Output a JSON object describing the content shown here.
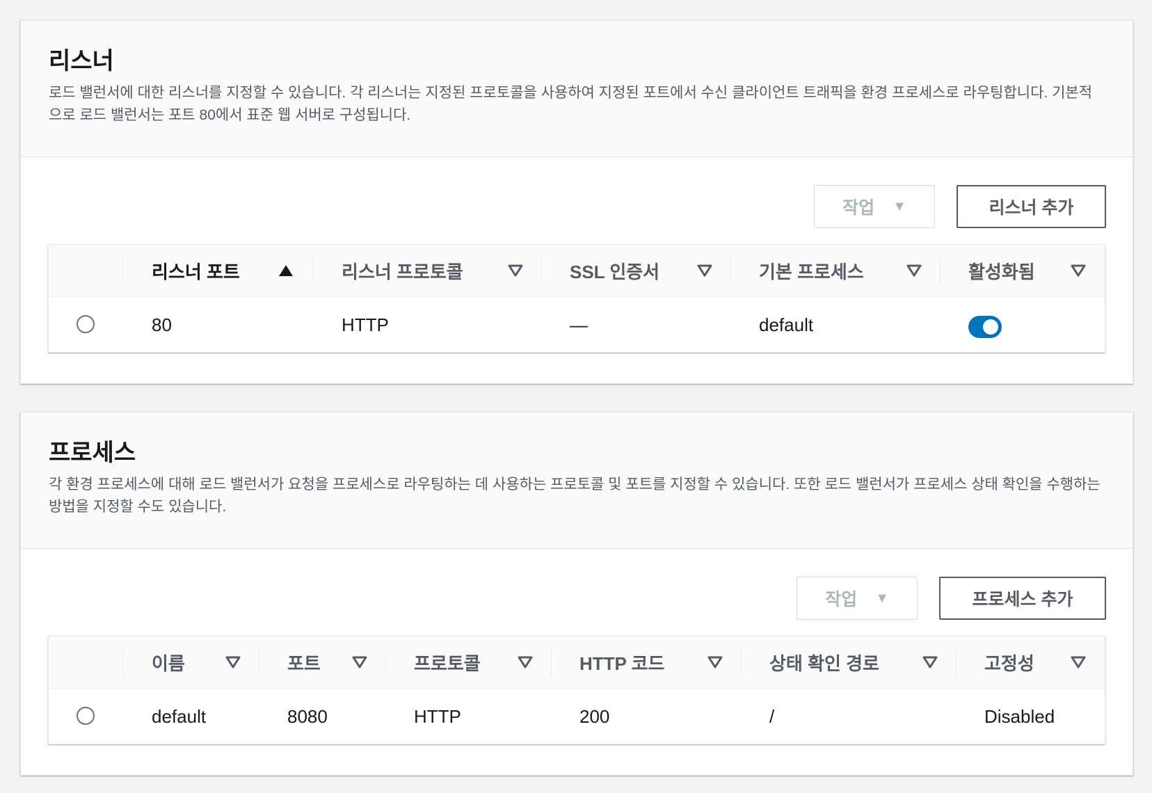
{
  "listeners": {
    "title": "리스너",
    "description": "로드 밸런서에 대한 리스너를 지정할 수 있습니다. 각 리스너는 지정된 프로토콜을 사용하여 지정된 포트에서 수신 클라이언트 트래픽을 환경 프로세스로 라우팅합니다. 기본적으로 로드 밸런서는 포트 80에서 표준 웹 서버로 구성됩니다.",
    "actions_label": "작업",
    "add_label": "리스너 추가",
    "columns": [
      "리스너 포트",
      "리스너 프로토콜",
      "SSL 인증서",
      "기본 프로세스",
      "활성화됨"
    ],
    "sorted_column": "리스너 포트",
    "rows": [
      {
        "port": "80",
        "protocol": "HTTP",
        "ssl": "—",
        "process": "default",
        "enabled": true
      }
    ]
  },
  "processes": {
    "title": "프로세스",
    "description": "각 환경 프로세스에 대해 로드 밸런서가 요청을 프로세스로 라우팅하는 데 사용하는 프로토콜 및 포트를 지정할 수 있습니다. 또한 로드 밸런서가 프로세스 상태 확인을 수행하는 방법을 지정할 수도 있습니다.",
    "actions_label": "작업",
    "add_label": "프로세스 추가",
    "columns": [
      "이름",
      "포트",
      "프로토콜",
      "HTTP 코드",
      "상태 확인 경로",
      "고정성"
    ],
    "rows": [
      {
        "name": "default",
        "port": "8080",
        "protocol": "HTTP",
        "http_code": "200",
        "path": "/",
        "stickiness": "Disabled"
      }
    ]
  },
  "colors": {
    "toggle_on": "#0073bb",
    "text": "#16191f",
    "muted": "#545b64"
  },
  "icons": {
    "sort_ascending": "sort-ascending-icon",
    "sort_none": "sort-icon",
    "dropdown": "caret-down-icon"
  }
}
